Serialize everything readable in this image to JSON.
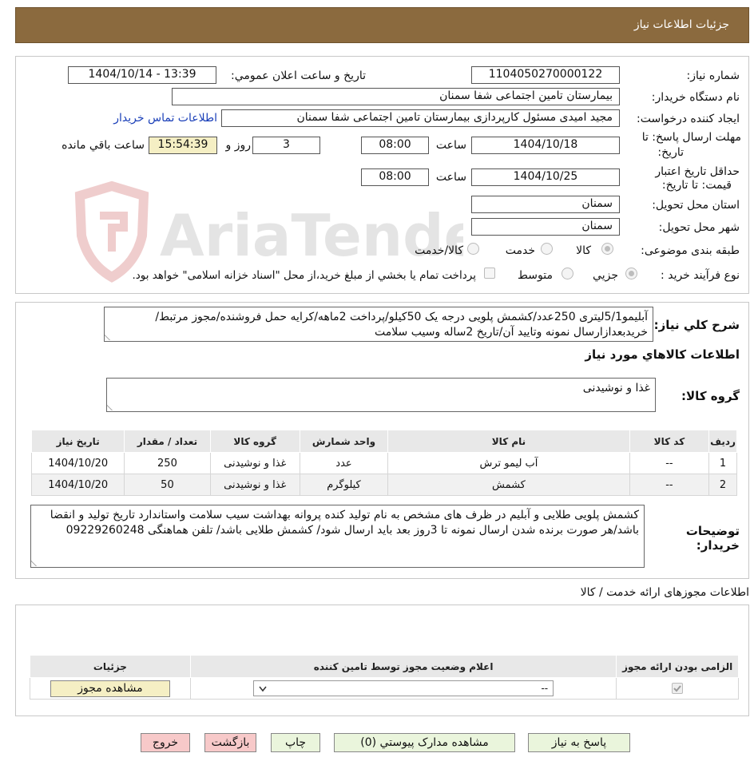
{
  "header": {
    "title": "جزئیات اطلاعات نیاز"
  },
  "watermark": {
    "text": "AriaTender.neT"
  },
  "form": {
    "need_number": {
      "label": "شماره نیاز:",
      "value": "1104050270000122"
    },
    "announce": {
      "label": "تاریخ و ساعت اعلان عمومي:",
      "value": "1404/10/14 - 13:39"
    },
    "buyer_org": {
      "label": "نام دستگاه خريدار:",
      "value": "بیمارستان تامین اجتماعی شفا سمنان"
    },
    "requester": {
      "label": "ايجاد کننده درخواست:",
      "value": "مجید امیدی مسئول کارپردازی بیمارستان تامین اجتماعی شفا سمنان",
      "contact_link": "اطلاعات تماس خريدار"
    },
    "deadline": {
      "label_line1": "مهلت ارسال پاسخ: تا",
      "label_line2": "تاریخ:",
      "date": "1404/10/18",
      "time_label": "ساعت",
      "time": "08:00",
      "days": "3",
      "days_label": "روز و",
      "remaining": "15:54:39",
      "remaining_label": "ساعت باقي مانده"
    },
    "validity": {
      "label_line1": "حداقل تاريخ اعتبار",
      "label_line2": "قيمت: تا تاريخ:",
      "date": "1404/10/25",
      "time_label": "ساعت",
      "time": "08:00"
    },
    "province": {
      "label": "استان محل تحويل:",
      "value": "سمنان"
    },
    "city": {
      "label": "شهر محل تحويل:",
      "value": "سمنان"
    },
    "category": {
      "label": "طبقه بندی موضوعی:",
      "options": [
        "کالا",
        "خدمت",
        "کالا/خدمت"
      ],
      "selected": "کالا"
    },
    "process": {
      "label": "نوع فرآيند خريد :",
      "options": [
        "جزيي",
        "متوسط"
      ],
      "selected": "جزيي",
      "note": "پرداخت تمام يا بخشي از مبلغ خريد،از محل \"اسناد خزانه اسلامی\" خواهد بود."
    }
  },
  "description": {
    "label": "شرح کلي نياز:",
    "text": "آبلیمو5/1لیتری 250عدد/کشمش پلویی درجه یک 50کیلو/پرداخت 2ماهه/کرایه حمل فروشنده/مجوز مرتبط/خریدبعدازارسال نمونه وتایید آن/تاریخ 2ساله وسیب سلامت"
  },
  "goods": {
    "section_title": "اطلاعات کالاهاي مورد نياز",
    "group_label": "گروه کالا:",
    "group_value": "غذا و نوشیدنی",
    "columns": [
      "رديف",
      "کد کالا",
      "نام کالا",
      "واحد شمارش",
      "گروه کالا",
      "تعداد / مقدار",
      "تاريخ نياز"
    ],
    "rows": [
      [
        "1",
        "--",
        "آب لیمو ترش",
        "عدد",
        "غذا و نوشیدنی",
        "250",
        "1404/10/20"
      ],
      [
        "2",
        "--",
        "کشمش",
        "کیلوگرم",
        "غذا و نوشیدنی",
        "50",
        "1404/10/20"
      ]
    ]
  },
  "buyer_notes": {
    "label_line1": "توضيحات",
    "label_line2": "خريدار:",
    "text": "کشمش پلویی طلایی و آبلیم در ظرف های مشخص به نام تولید کنده پروانه بهداشت سیب سلامت واستاندارد تاریخ تولید و انقضا باشد/هر صورت برنده شدن ارسال نمونه تا 3روز بعد باید ارسال شود/ کشمش طلایی باشد/ تلفن هماهنگی 09229260248"
  },
  "permits": {
    "section_title": "اطلاعات مجوزهای ارائه خدمت / کالا",
    "columns": [
      "الزامی بودن ارائه مجوز",
      "اعلام وضعیت مجوز توسط تامین کننده",
      "جزئیات"
    ],
    "select_value": "--",
    "view_button": "مشاهده مجوز"
  },
  "buttons": {
    "reply": "پاسخ به نياز",
    "attachments": "مشاهده مدارک پيوستي (0)",
    "print": "چاپ",
    "back": "بازگشت",
    "exit": "خروج"
  }
}
